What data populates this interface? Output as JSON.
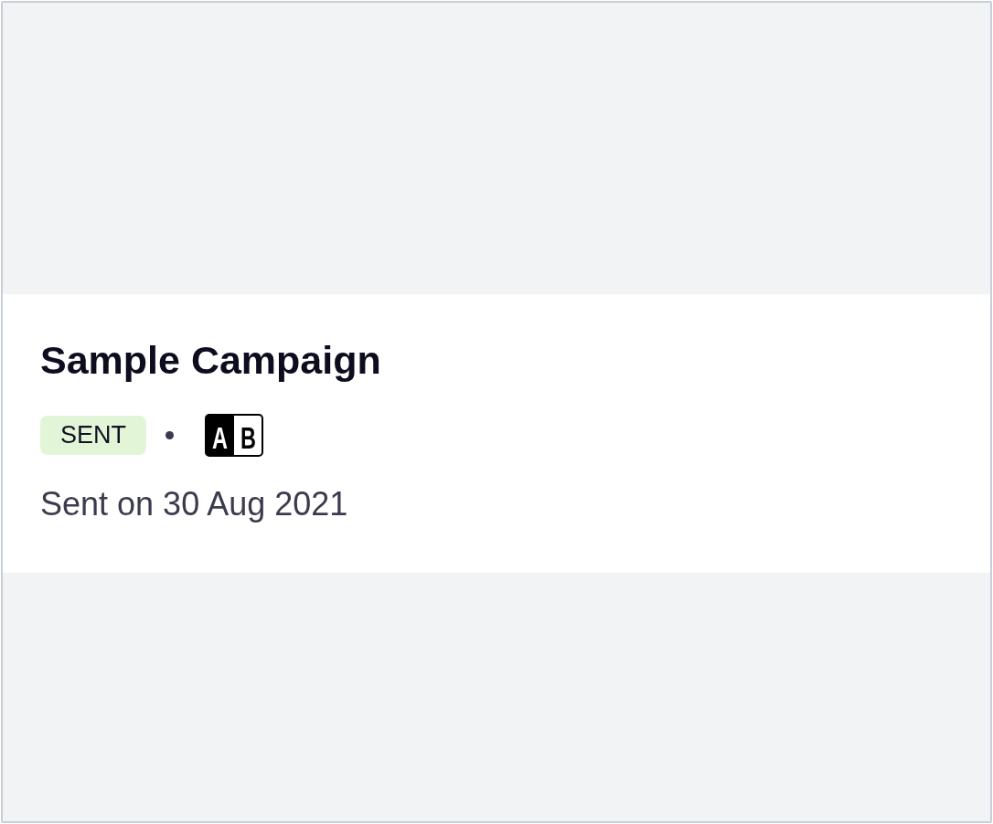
{
  "campaign": {
    "title": "Sample Campaign",
    "status": {
      "label": "SENT",
      "kind": "sent"
    },
    "variant_icon": {
      "letters": [
        "A",
        "B"
      ]
    },
    "sent_date": "Sent on 30 Aug 2021"
  }
}
